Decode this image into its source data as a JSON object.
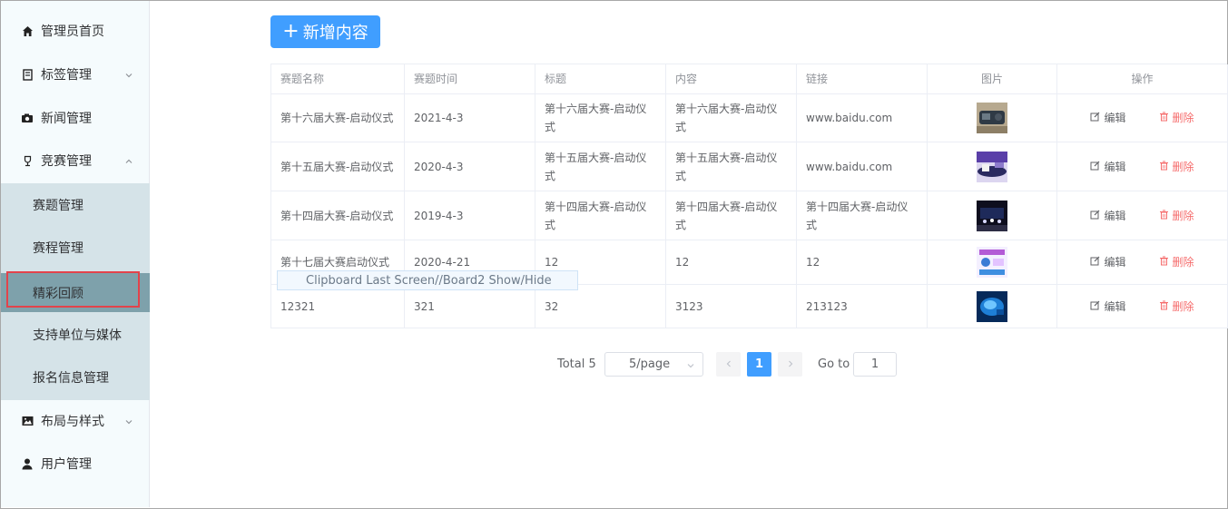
{
  "sidebar": {
    "items": [
      {
        "label": "管理员首页",
        "icon": "home-icon"
      },
      {
        "label": "标签管理",
        "icon": "tag-book-icon"
      },
      {
        "label": "新闻管理",
        "icon": "camera-icon"
      },
      {
        "label": "竞赛管理",
        "icon": "trophy-icon"
      },
      {
        "label": "布局与样式",
        "icon": "image-icon"
      },
      {
        "label": "用户管理",
        "icon": "user-icon"
      }
    ],
    "submenu": [
      {
        "label": "赛题管理"
      },
      {
        "label": "赛程管理"
      },
      {
        "label": "精彩回顾",
        "active": true
      },
      {
        "label": "支持单位与媒体"
      },
      {
        "label": "报名信息管理"
      }
    ]
  },
  "toolbar": {
    "add_label": "新增内容",
    "add_icon": "plus-icon"
  },
  "table": {
    "headers": [
      "赛题名称",
      "赛题时间",
      "标题",
      "内容",
      "链接",
      "图片",
      "操作"
    ],
    "rows": [
      {
        "name": "第十六届大赛-启动仪式",
        "time": "2021-4-3",
        "title": "第十六届大赛-启动仪式",
        "content": "第十六届大赛-启动仪式",
        "link": "www.baidu.com",
        "image": "thumbnail-robot"
      },
      {
        "name": "第十五届大赛-启动仪式",
        "time": "2020-4-3",
        "title": "第十五届大赛-启动仪式",
        "content": "第十五届大赛-启动仪式",
        "link": "www.baidu.com",
        "image": "thumbnail-purple-stage"
      },
      {
        "name": "第十四届大赛-启动仪式",
        "time": "2019-4-3",
        "title": "第十四届大赛-启动仪式",
        "content": "第十四届大赛-启动仪式",
        "link": "第十四届大赛-启动仪式",
        "image": "thumbnail-dark-stage"
      },
      {
        "name": "第十七届大赛启动仪式",
        "time": "2020-4-21",
        "title": "12",
        "content": "12",
        "link": "12",
        "image": "thumbnail-poster"
      },
      {
        "name": "12321",
        "time": "321",
        "title": "32",
        "content": "3123",
        "link": "213123",
        "image": "thumbnail-blue-render"
      }
    ],
    "edit_label": "编辑",
    "delete_label": "删除"
  },
  "tooltip": {
    "text": "Clipboard Last Screen//Board2 Show/Hide"
  },
  "pagination": {
    "total_text": "Total 5",
    "page_size": "5/page",
    "current_page": "1",
    "goto_label": "Go to",
    "goto_value": "1"
  },
  "colors": {
    "primary": "#409eff",
    "danger": "#f56c6c",
    "submenu_bg": "#d5e3e8",
    "active_bg": "#7ea1ab"
  }
}
